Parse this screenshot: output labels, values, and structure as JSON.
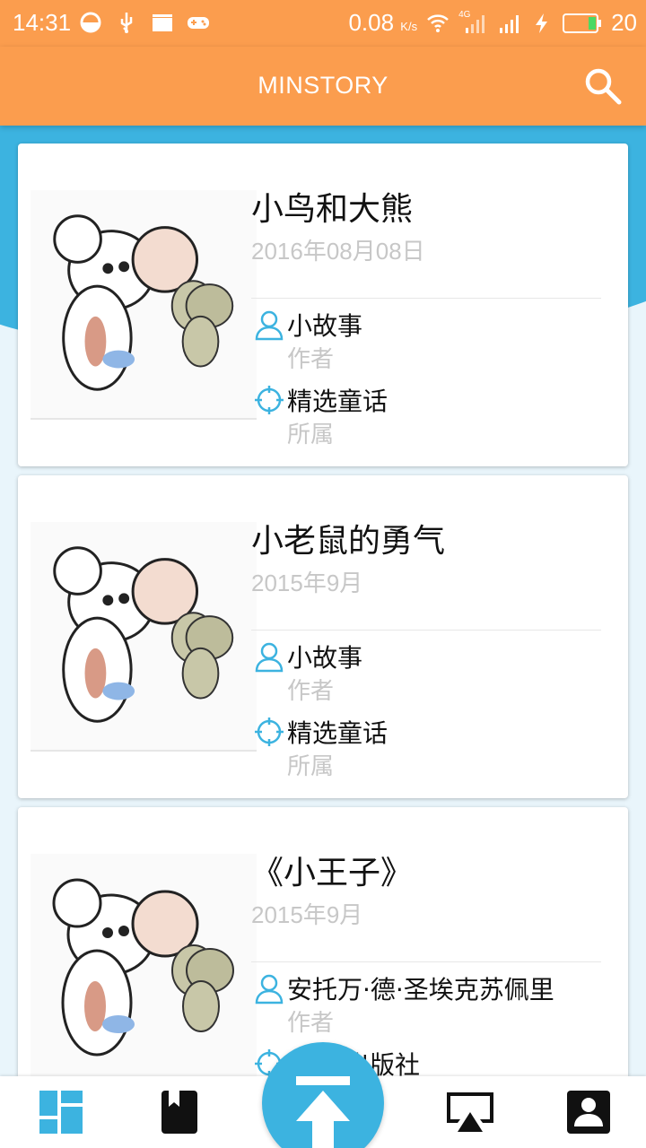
{
  "status_bar": {
    "time": "14:31",
    "network_speed": "0.08",
    "network_unit": "K/s",
    "signal_label": "4G",
    "battery": "20"
  },
  "app_bar": {
    "title": "MINSTORY"
  },
  "stories": [
    {
      "title": "小鸟和大熊",
      "date": "2016年08月08日",
      "author": "小故事",
      "author_label": "作者",
      "category": "精选童话",
      "category_label": "所属"
    },
    {
      "title": "小老鼠的勇气",
      "date": "2015年9月",
      "author": "小故事",
      "author_label": "作者",
      "category": "精选童话",
      "category_label": "所属"
    },
    {
      "title": "《小王子》",
      "date": "2015年9月",
      "author": "安托万·德·圣埃克苏佩里",
      "author_label": "作者",
      "category": "育出版社",
      "category_label": ""
    }
  ],
  "bottom_nav": [
    {
      "icon": "dashboard-icon",
      "active": true
    },
    {
      "icon": "bookmark-icon",
      "active": false
    },
    {
      "icon": "upload-icon",
      "active": false
    },
    {
      "icon": "airplay-icon",
      "active": false
    },
    {
      "icon": "contact-icon",
      "active": false
    }
  ],
  "colors": {
    "primary": "#fb9d4e",
    "accent": "#3cb3e0",
    "text": "#111111",
    "muted": "#c7c7c7"
  }
}
